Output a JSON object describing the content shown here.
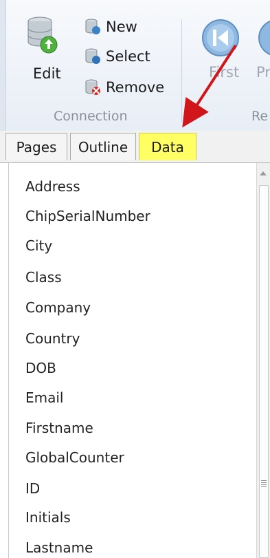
{
  "ribbon": {
    "edit_label": "Edit",
    "new_label": "New",
    "select_label": "Select",
    "remove_label": "Remove",
    "connection_group": "Connection",
    "first_label": "First",
    "prev_label": "Pr",
    "next_group_label": "Re"
  },
  "tabs": [
    {
      "label": "Pages"
    },
    {
      "label": "Outline"
    },
    {
      "label": "Data"
    }
  ],
  "fields": [
    "Address",
    "ChipSerialNumber",
    "City",
    "Class",
    "Company",
    "Country",
    "DOB",
    "Email",
    "Firstname",
    "GlobalCounter",
    "ID",
    "Initials",
    "Lastname"
  ],
  "colors": {
    "active_tab": "#ffff63",
    "annotation_arrow": "#d0161b",
    "nav_button": "#8fb8e0"
  }
}
